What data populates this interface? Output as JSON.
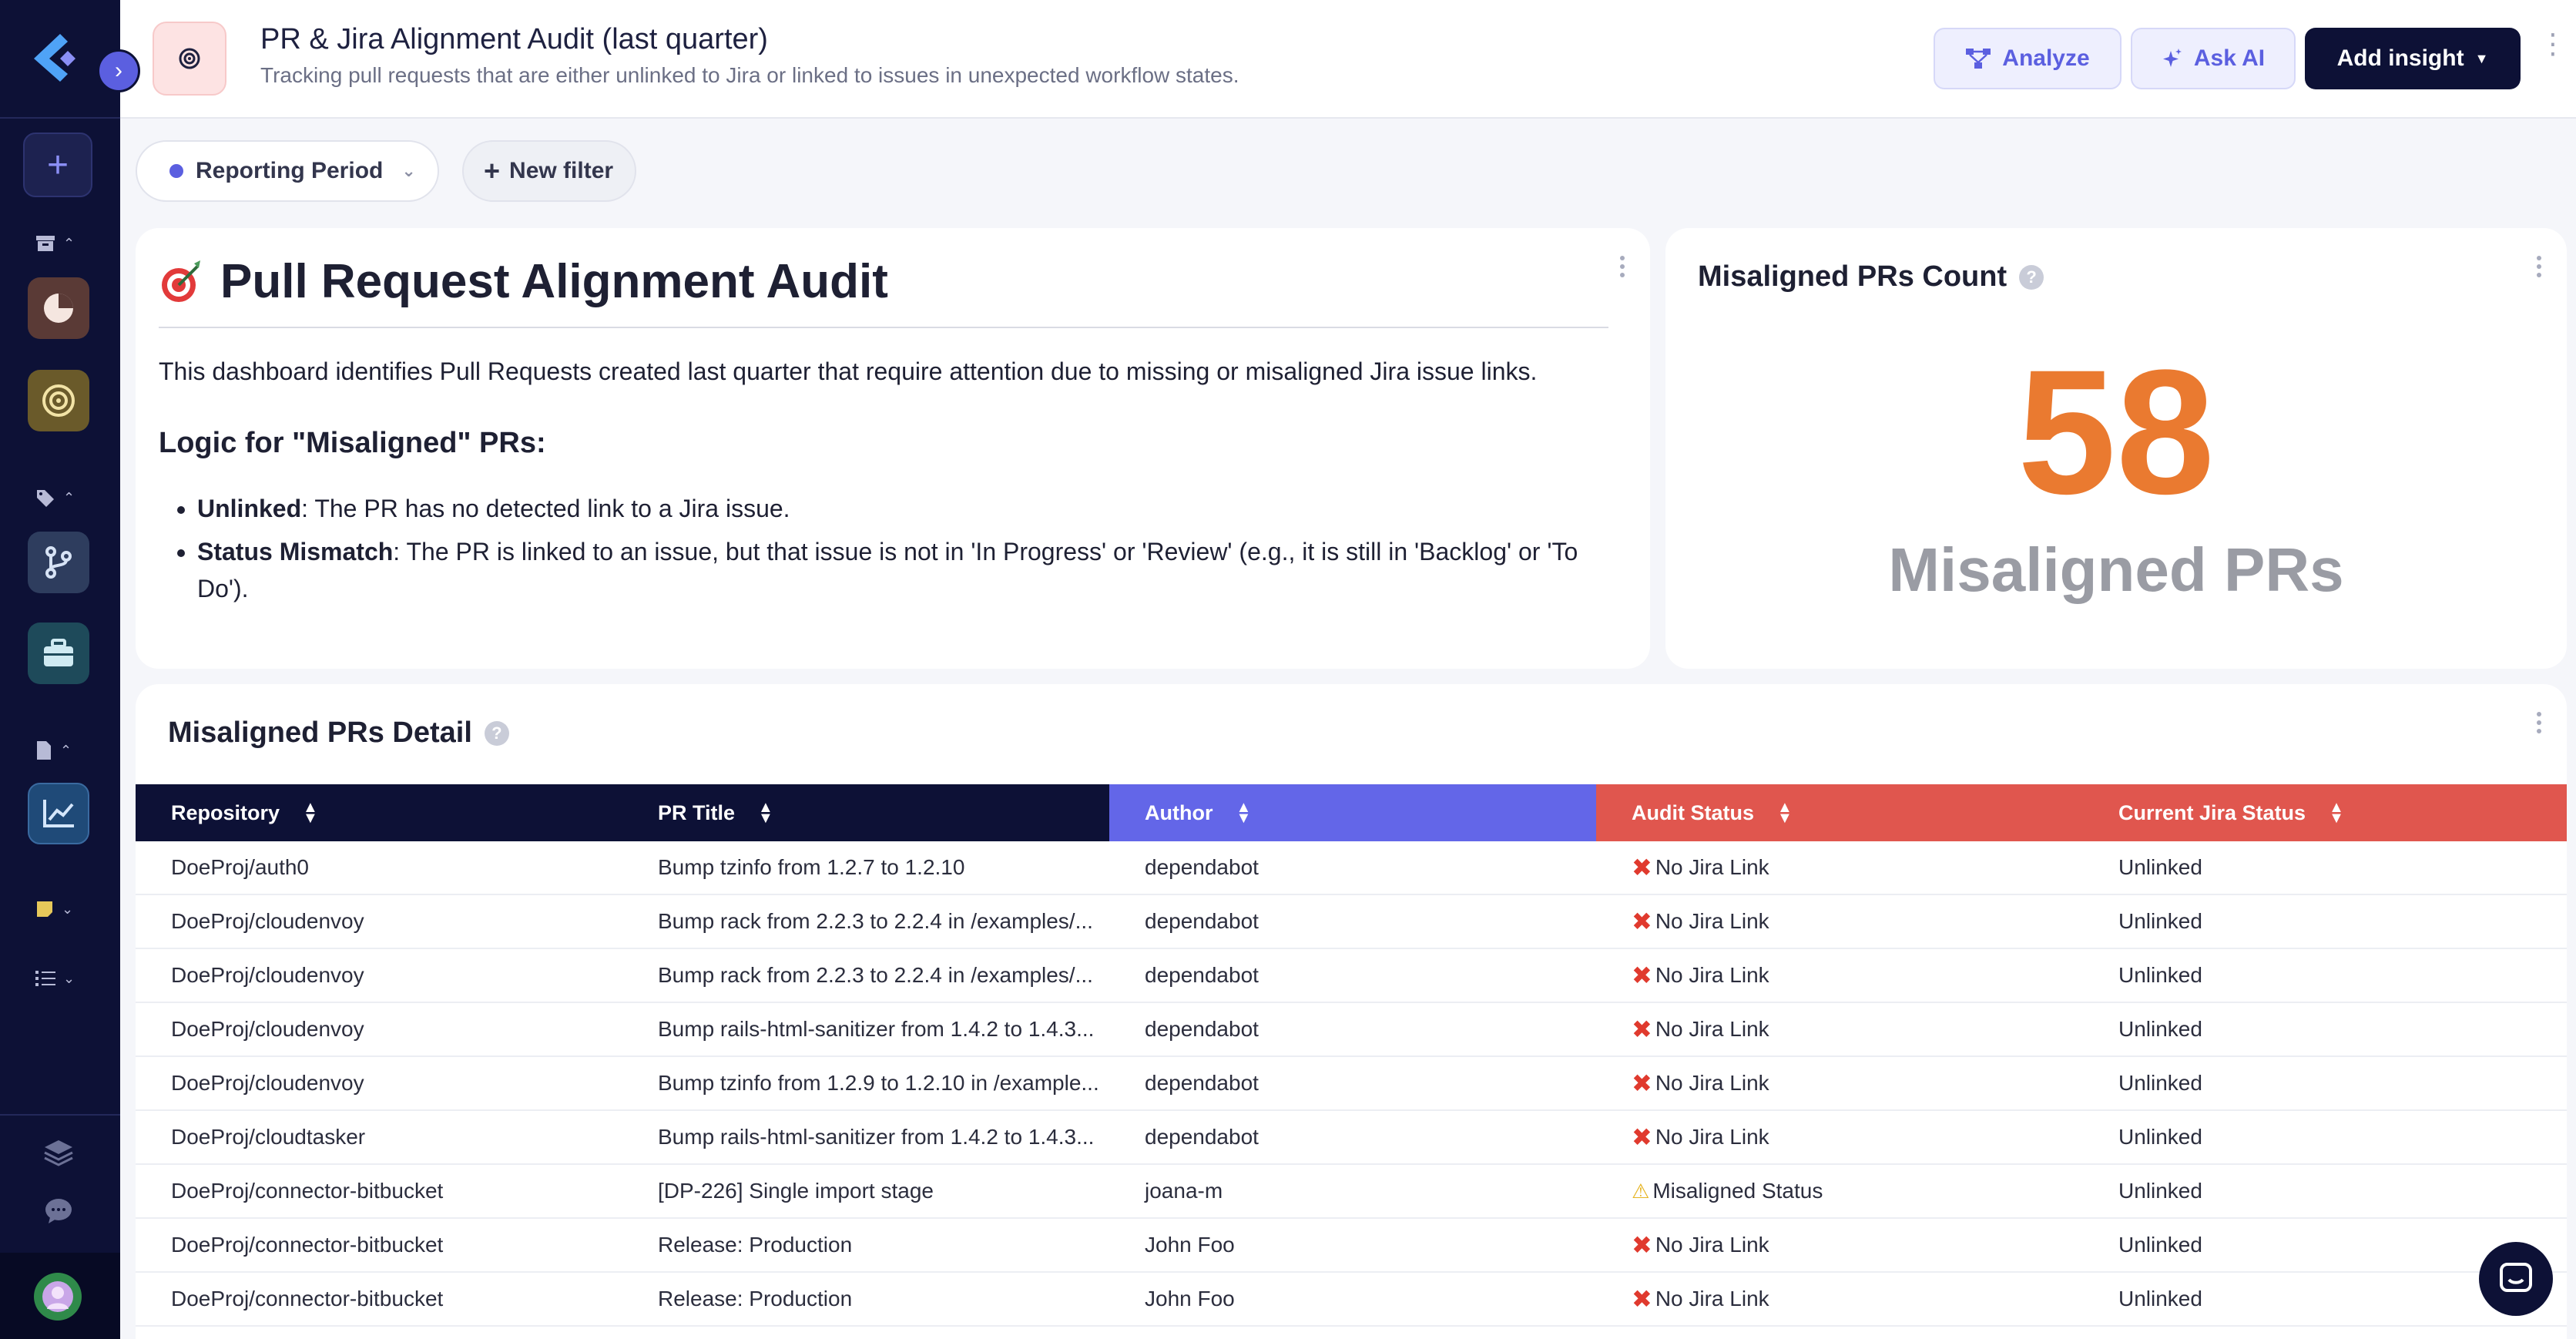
{
  "header": {
    "title": "PR & Jira Alignment Audit (last quarter)",
    "subtitle": "Tracking pull requests that are either unlinked to Jira or linked to issues in unexpected workflow states.",
    "analyze_label": "Analyze",
    "ask_ai_label": "Ask AI",
    "add_insight_label": "Add insight"
  },
  "filters": {
    "period_label": "Reporting Period",
    "new_filter_label": "New filter"
  },
  "text_card": {
    "title": "Pull Request Alignment Audit",
    "intro": "This dashboard identifies Pull Requests created last quarter that require attention due to missing or misaligned Jira issue links.",
    "logic_heading": "Logic for \"Misaligned\" PRs:",
    "items": [
      {
        "term": "Unlinked",
        "text": ": The PR has no detected link to a Jira issue."
      },
      {
        "term": "Status Mismatch",
        "text": ": The PR is linked to an issue, but that issue is not in 'In Progress' or 'Review' (e.g., it is still in 'Backlog' or 'To Do')."
      }
    ]
  },
  "count_card": {
    "title": "Misaligned PRs Count",
    "value": "58",
    "label": "Misaligned PRs"
  },
  "table_card": {
    "title": "Misaligned PRs Detail",
    "columns": [
      {
        "label": "Repository",
        "color": "#0d1136"
      },
      {
        "label": "PR Title",
        "color": "#0d1136"
      },
      {
        "label": "Author",
        "color": "#6366e8"
      },
      {
        "label": "Audit Status",
        "color": "#e0564e"
      },
      {
        "label": "Current Jira Status",
        "color": "#e0564e"
      }
    ],
    "rows": [
      {
        "repo": "DoeProj/auth0",
        "title": "Bump tzinfo from 1.2.7 to 1.2.10",
        "author": "dependabot",
        "audit": "No Jira Link",
        "audit_icon": "x",
        "jira": "Unlinked"
      },
      {
        "repo": "DoeProj/cloudenvoy",
        "title": "Bump rack from 2.2.3 to 2.2.4 in /examples/...",
        "author": "dependabot",
        "audit": "No Jira Link",
        "audit_icon": "x",
        "jira": "Unlinked"
      },
      {
        "repo": "DoeProj/cloudenvoy",
        "title": "Bump rack from 2.2.3 to 2.2.4 in /examples/...",
        "author": "dependabot",
        "audit": "No Jira Link",
        "audit_icon": "x",
        "jira": "Unlinked"
      },
      {
        "repo": "DoeProj/cloudenvoy",
        "title": "Bump rails-html-sanitizer from 1.4.2 to 1.4.3...",
        "author": "dependabot",
        "audit": "No Jira Link",
        "audit_icon": "x",
        "jira": "Unlinked"
      },
      {
        "repo": "DoeProj/cloudenvoy",
        "title": "Bump tzinfo from 1.2.9 to 1.2.10 in /example...",
        "author": "dependabot",
        "audit": "No Jira Link",
        "audit_icon": "x",
        "jira": "Unlinked"
      },
      {
        "repo": "DoeProj/cloudtasker",
        "title": "Bump rails-html-sanitizer from 1.4.2 to 1.4.3...",
        "author": "dependabot",
        "audit": "No Jira Link",
        "audit_icon": "x",
        "jira": "Unlinked"
      },
      {
        "repo": "DoeProj/connector-bitbucket",
        "title": "[DP-226] Single import stage",
        "author": "joana-m",
        "audit": "Misaligned Status",
        "audit_icon": "warn",
        "jira": "Unlinked"
      },
      {
        "repo": "DoeProj/connector-bitbucket",
        "title": "Release: Production",
        "author": "John Foo",
        "audit": "No Jira Link",
        "audit_icon": "x",
        "jira": "Unlinked"
      },
      {
        "repo": "DoeProj/connector-bitbucket",
        "title": "Release: Production",
        "author": "John Foo",
        "audit": "No Jira Link",
        "audit_icon": "x",
        "jira": "Unlinked"
      }
    ]
  }
}
